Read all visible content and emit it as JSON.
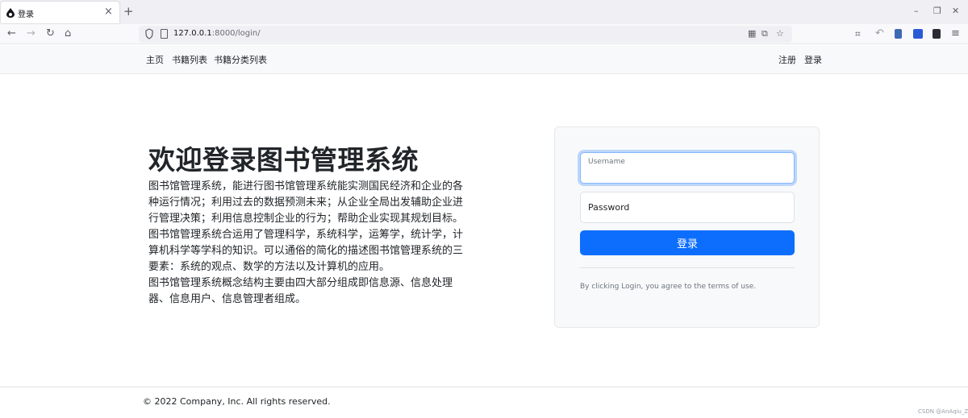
{
  "browser": {
    "tab_title": "登录",
    "tab_close": "×",
    "new_tab": "+",
    "url_host": "127.0.0.1",
    "url_rest": ":8000/login/",
    "window_controls": {
      "minimize": "–",
      "restore": "❐",
      "close": "✕"
    },
    "nav": {
      "back": "←",
      "forward": "→",
      "reload": "↻",
      "home": "⌂"
    },
    "icons": [
      "shield-icon",
      "page-icon",
      "qr-code-icon",
      "translate-icon",
      "bookmark-star-icon",
      "crop-icon",
      "undo-icon",
      "extension-icon",
      "translate-extension-icon",
      "library-icon",
      "menu-icon"
    ],
    "url_right": {
      "qr": "▦",
      "translate": "⧉",
      "star": "☆"
    },
    "toolbar_glyphs": {
      "crop": "⌗",
      "undo": "↶",
      "menu": "≡"
    }
  },
  "site_nav": {
    "left": [
      {
        "label": "主页"
      },
      {
        "label": "书籍列表"
      },
      {
        "label": "书籍分类列表"
      }
    ],
    "right": [
      {
        "label": "注册"
      },
      {
        "label": "登录"
      }
    ]
  },
  "hero": {
    "title": "欢迎登录图书管理系统",
    "paragraphs": [
      "图书馆管理系统，能进行图书馆管理系统能实测国民经济和企业的各种运行情况；利用过去的数据预测未来；从企业全局出发辅助企业进行管理决策；利用信息控制企业的行为；帮助企业实现其规划目标。",
      "图书馆管理系统合运用了管理科学，系统科学，运筹学，统计学，计算机科学等学科的知识。可以通俗的简化的描述图书馆管理系统的三要素：系统的观点、数学的方法以及计算机的应用。",
      "图书馆管理系统概念结构主要由四大部分组成即信息源、信息处理器、信息用户、信息管理者组成。"
    ]
  },
  "login_form": {
    "username_label": "Username",
    "username_value": "",
    "password_label": "Password",
    "password_value": "",
    "submit_label": "登录",
    "terms_text": "By clicking Login, you agree to the terms of use."
  },
  "footer": {
    "copyright": "© 2022 Company, Inc. All rights reserved."
  },
  "watermark": "CSDN @AnAqiu_Z",
  "colors": {
    "primary": "#0d6efd",
    "focus_border": "#86b7fe",
    "navbar_bg": "#f8f9fa",
    "text": "#212529",
    "muted": "#6c757d"
  }
}
